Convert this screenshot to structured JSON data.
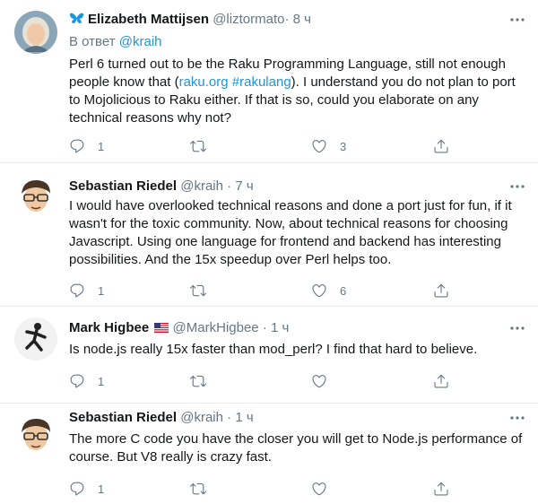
{
  "tweets": [
    {
      "name": "Elizabeth Mattijsen",
      "handle": "@liztormato",
      "dot": "·",
      "time": "8 ч",
      "reply_prefix": "В ответ",
      "reply_mention": "@kraih",
      "text_lines": [
        [
          "Perl 6 turned out to be the Raku Programming Language, still not enough"
        ],
        [
          "people know that (",
          "raku.org",
          " ",
          "#rakulang",
          ").  I understand you do not plan to port"
        ],
        [
          "to Mojolicious to Raku either.  If that is so, could you elaborate on any"
        ],
        [
          "technical reasons why not?"
        ]
      ],
      "reply_count": "1",
      "retweet_count": "",
      "like_count": "3"
    },
    {
      "name": "Sebastian Riedel",
      "handle": "@kraih",
      "dot": "·",
      "time": "7 ч",
      "text": "I would have overlooked technical reasons and done a port just for fun, if it wasn't for the toxic community. Now, about technical reasons for choosing Javascript. Using one language for frontend and backend has interesting possibilities. And the 15x speedup over Perl helps too.",
      "reply_count": "1",
      "retweet_count": "",
      "like_count": "6"
    },
    {
      "name": "Mark Higbee",
      "handle": "@MarkHigbee",
      "dot": "·",
      "time": "1 ч",
      "text": "Is node.js really 15x faster than mod_perl? I find that hard to believe.",
      "reply_count": "1",
      "retweet_count": "",
      "like_count": ""
    },
    {
      "name": "Sebastian Riedel",
      "handle": "@kraih",
      "dot": "·",
      "time": "1 ч",
      "text": "The more C code you have the closer you will get to Node.js performance of course. But V8 really is crazy fast.",
      "reply_count": "1",
      "retweet_count": "",
      "like_count": ""
    }
  ],
  "colors": {
    "text": "#14171a",
    "secondary": "#657786",
    "link": "#1b95e0",
    "divider": "#e6ecf0"
  },
  "icons": [
    "butterfly-icon",
    "us-flag-icon",
    "reply-icon",
    "retweet-icon",
    "like-icon",
    "share-icon",
    "more-icon"
  ]
}
